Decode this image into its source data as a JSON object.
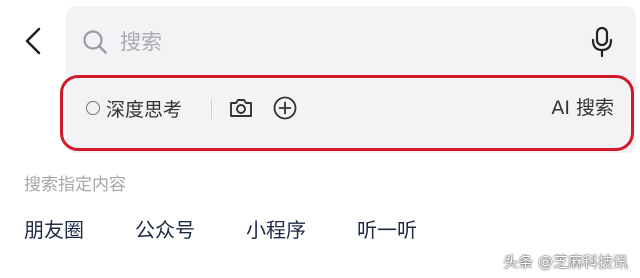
{
  "header": {
    "back_icon": "chevron-left-icon",
    "search": {
      "placeholder": "搜索",
      "search_icon": "search-icon",
      "mic_icon": "microphone-icon"
    }
  },
  "options": {
    "deep_think_label": "深度思考",
    "deep_think_selected": false,
    "camera_icon": "camera-icon",
    "add_icon": "plus-circle-icon",
    "ai_search_label": "AI 搜索",
    "highlight_color": "#d01a2a"
  },
  "section": {
    "title": "搜索指定内容",
    "items": [
      {
        "label": "朋友圈"
      },
      {
        "label": "公众号"
      },
      {
        "label": "小程序"
      },
      {
        "label": "听一听"
      }
    ]
  },
  "watermark": {
    "text": "头条 @芝麻科技讯"
  },
  "colors": {
    "panel_background": "#f3f3f6",
    "placeholder_text": "#a9a9ae",
    "filter_text": "#1e2a44"
  }
}
